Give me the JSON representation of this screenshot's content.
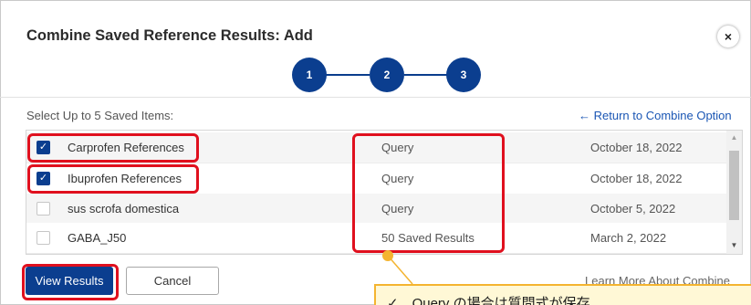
{
  "dialog": {
    "title": "Combine Saved Reference Results: Add",
    "close_glyph": "×",
    "steps": [
      "1",
      "2",
      "3"
    ],
    "select_label": "Select Up to 5 Saved Items:",
    "return_link": "← Return to Combine Option"
  },
  "items": [
    {
      "name": "Carprofen References",
      "type": "Query",
      "date": "October 18, 2022",
      "checked": true
    },
    {
      "name": "Ibuprofen References",
      "type": "Query",
      "date": "October 18, 2022",
      "checked": true
    },
    {
      "name": "sus scrofa domestica",
      "type": "Query",
      "date": "October 5, 2022",
      "checked": false
    },
    {
      "name": "GABA_J50",
      "type": "50 Saved Results",
      "date": "March 2, 2022",
      "checked": false
    }
  ],
  "footer": {
    "view_results_label": "View Results",
    "cancel_label": "Cancel",
    "learn_more_label": "Learn More About Combine"
  },
  "annotation": {
    "callout_text": "✓　Query の場合は質問式が保存",
    "highlight_color": "#e0101e",
    "callout_color": "#f4b430"
  },
  "icons": {
    "checkmark": "✓",
    "scroll_up": "▲",
    "scroll_down": "▼"
  },
  "colors": {
    "primary": "#0b3e8f",
    "link": "#1a56b4"
  }
}
